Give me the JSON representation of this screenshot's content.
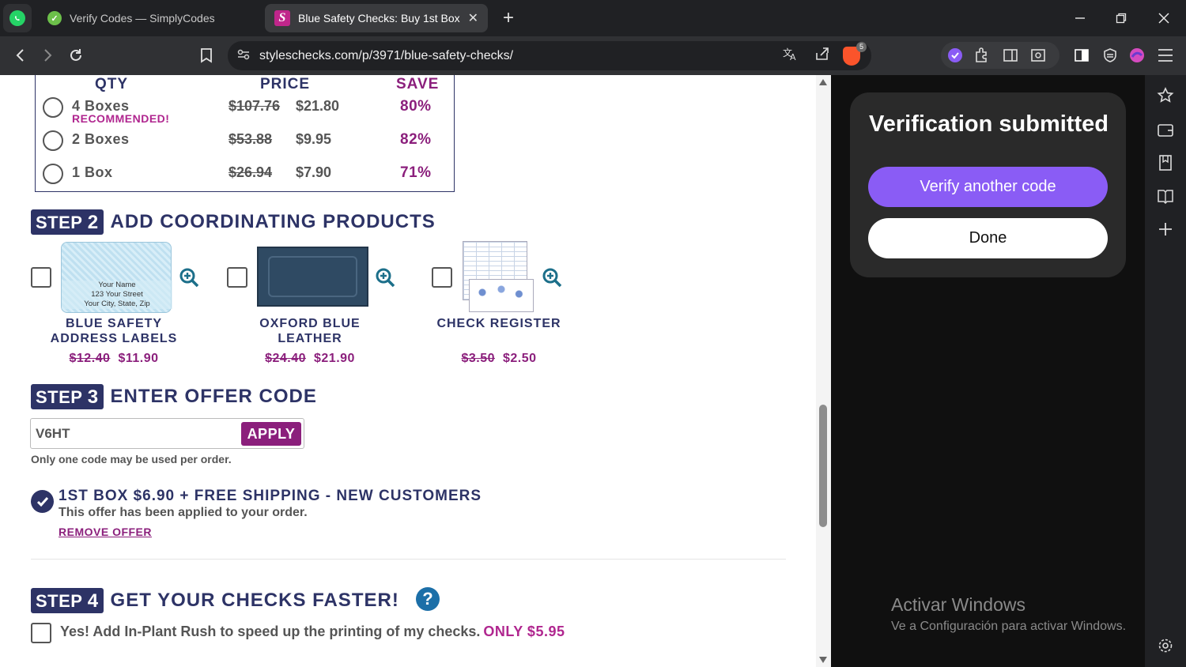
{
  "browser": {
    "tabs": [
      {
        "title": "Verify Codes — SimplyCodes"
      },
      {
        "title": "Blue Safety Checks: Buy 1st Box,"
      }
    ],
    "new_tab": "+",
    "close_tab": "✕",
    "url": "styleschecks.com/p/3971/blue-safety-checks/",
    "brave_badge": "5"
  },
  "qty_table": {
    "headers": {
      "qty": "QTY",
      "price": "PRICE",
      "save": "SAVE"
    },
    "rows": [
      {
        "label": "4 Boxes",
        "tag": "RECOMMENDED!",
        "old_price": "$107.76",
        "price": "$21.80",
        "save": "80%"
      },
      {
        "label": "2 Boxes",
        "tag": "",
        "old_price": "$53.88",
        "price": "$9.95",
        "save": "82%"
      },
      {
        "label": "1 Box",
        "tag": "",
        "old_price": "$26.94",
        "price": "$7.90",
        "save": "71%"
      }
    ]
  },
  "step2": {
    "badge": "STEP",
    "num": "2",
    "title": "ADD COORDINATING PRODUCTS",
    "products": [
      {
        "name_line1": "BLUE SAFETY",
        "name_line2": "ADDRESS LABELS",
        "old_price": "$12.40",
        "price": "$11.90",
        "preview": {
          "line1": "Your Name",
          "line2": "123 Your Street",
          "line3": "Your City, State, Zip"
        }
      },
      {
        "name_line1": "OXFORD BLUE",
        "name_line2": "LEATHER",
        "old_price": "$24.40",
        "price": "$21.90"
      },
      {
        "name_line1": "CHECK REGISTER",
        "name_line2": "",
        "old_price": "$3.50",
        "price": "$2.50"
      }
    ]
  },
  "step3": {
    "badge": "STEP",
    "num": "3",
    "title": "ENTER OFFER CODE",
    "code_value": "V6HT",
    "apply_label": "APPLY",
    "note": "Only one code may be used per order.",
    "applied_offer": {
      "title": "1ST BOX $6.90 + FREE SHIPPING - NEW CUSTOMERS",
      "subtitle": "This offer has been applied to your order.",
      "remove_label": "REMOVE OFFER"
    }
  },
  "step4": {
    "badge": "STEP",
    "num": "4",
    "title": "GET YOUR CHECKS FASTER!",
    "help": "?",
    "rush_label": "Yes! Add In-Plant Rush to speed up the printing of my checks.",
    "rush_price": "ONLY $5.95"
  },
  "side_panel": {
    "title": "Verification submitted",
    "verify_another": "Verify another code",
    "done": "Done",
    "watermark_title": "Activar Windows",
    "watermark_sub": "Ve a Configuración para activar Windows."
  },
  "colors": {
    "navy": "#2d3366",
    "magenta": "#8b1f7c",
    "accent_purple": "#8a5cf5"
  }
}
